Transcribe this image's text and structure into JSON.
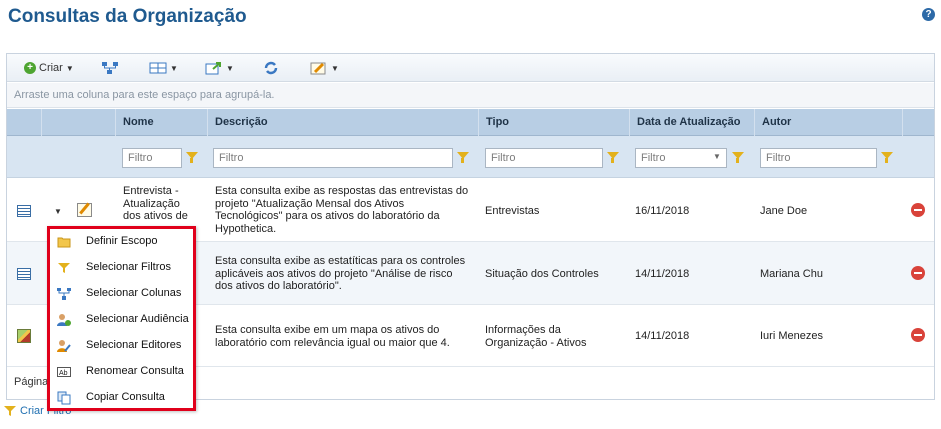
{
  "page": {
    "title": "Consultas da Organização",
    "help_symbol": "?"
  },
  "toolbar": {
    "create_label": "Criar"
  },
  "grouping_hint": "Arraste uma coluna para este espaço para agrupá-la.",
  "columns": [
    "Nome",
    "Descrição",
    "Tipo",
    "Data de Atualização",
    "Autor"
  ],
  "filters": {
    "placeholder": "Filtro"
  },
  "rows": [
    {
      "name_lines": [
        "Entrevista -",
        "Atualização",
        "dos ativos de"
      ],
      "description_lines": [
        "Esta consulta exibe as respostas das entrevistas do",
        "projeto \"Atualização Mensal dos Ativos",
        "Tecnológicos\" para os ativos do laboratório da",
        "Hypothetica."
      ],
      "type_lines": [
        "Entrevistas"
      ],
      "date": "16/11/2018",
      "author": "Jane Doe",
      "icon": "table-icon"
    },
    {
      "name_lines": [],
      "description_lines": [
        "Esta consulta exibe as estatíticas para os controles",
        "aplicáveis aos ativos do projeto \"Análise de risco",
        "dos ativos do laboratório\"."
      ],
      "type_lines": [
        "Situação dos Controles"
      ],
      "date": "14/11/2018",
      "author": "Mariana Chu",
      "icon": "table-icon"
    },
    {
      "name_lines": [],
      "description_lines": [
        "Esta consulta exibe em um mapa os ativos do",
        "laboratório com relevância igual ou maior que 4."
      ],
      "type_lines": [
        "Informações da",
        "Organização - Ativos"
      ],
      "date": "14/11/2018",
      "author": "Iuri Menezes",
      "icon": "map-icon"
    }
  ],
  "pager": {
    "label": "Página"
  },
  "footer": {
    "create_filter_label": "Criar Filtro"
  },
  "context_menu": {
    "items": [
      {
        "label": "Definir Escopo",
        "icon": "folder-icon"
      },
      {
        "label": "Selecionar Filtros",
        "icon": "filter-icon"
      },
      {
        "label": "Selecionar Colunas",
        "icon": "columns-icon"
      },
      {
        "label": "Selecionar Audiência",
        "icon": "users-icon"
      },
      {
        "label": "Selecionar Editores",
        "icon": "editors-icon"
      },
      {
        "label": "Renomear Consulta",
        "icon": "rename-icon"
      },
      {
        "label": "Copiar Consulta",
        "icon": "copy-icon"
      }
    ]
  },
  "colors": {
    "title": "#1f5a8f",
    "header_bg": "#b8cee4",
    "filter_bg": "#d8e5f2",
    "menu_border": "#e0001b",
    "delete": "#d9433a"
  }
}
